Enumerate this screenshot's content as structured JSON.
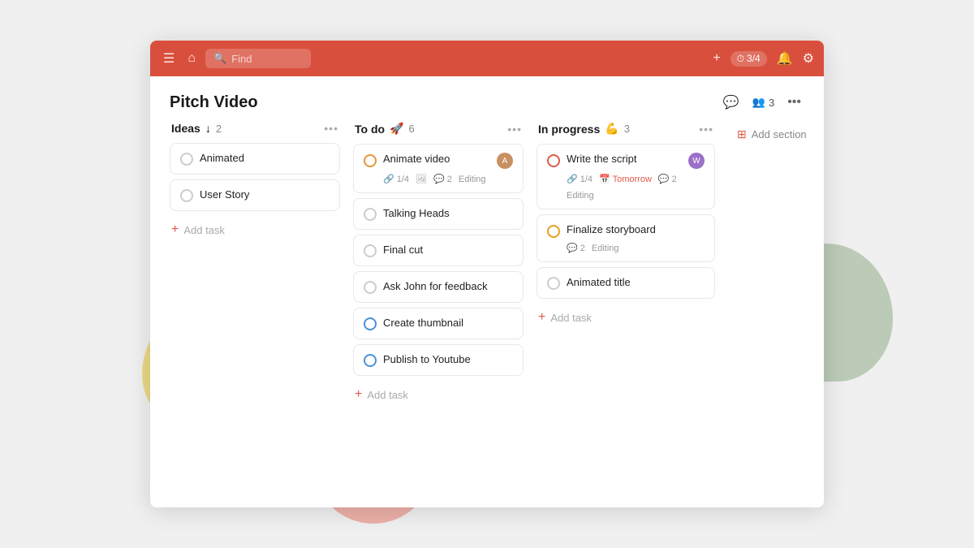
{
  "topbar": {
    "search_placeholder": "Find",
    "avatar_count": "3/4",
    "add_label": "+",
    "bell_icon": "🔔",
    "gear_icon": "⚙",
    "home_icon": "🏠",
    "menu_icon": "☰",
    "timer_icon": "⏱"
  },
  "page": {
    "title": "Pitch Video",
    "members_count": "3",
    "comment_icon": "💬",
    "more_icon": "•••"
  },
  "columns": [
    {
      "id": "ideas",
      "title": "Ideas",
      "emoji": "↓",
      "count": "2",
      "tasks": [
        {
          "id": 1,
          "name": "Animated",
          "circle": "default",
          "meta": []
        },
        {
          "id": 2,
          "name": "User Story",
          "circle": "default",
          "meta": []
        }
      ],
      "add_task_label": "Add task"
    },
    {
      "id": "todo",
      "title": "To do",
      "emoji": "🚀",
      "count": "6",
      "tasks": [
        {
          "id": 3,
          "name": "Animate video",
          "circle": "orange",
          "has_avatar": true,
          "avatar_type": "brown",
          "avatar_initial": "A",
          "meta": [
            {
              "icon": "🔗",
              "text": "1/4"
            },
            {
              "icon": "🖼",
              "text": ""
            },
            {
              "icon": "💬",
              "text": "2"
            },
            {
              "icon": "",
              "text": "Editing"
            }
          ]
        },
        {
          "id": 4,
          "name": "Talking Heads",
          "circle": "default",
          "meta": []
        },
        {
          "id": 5,
          "name": "Final cut",
          "circle": "default",
          "meta": []
        },
        {
          "id": 6,
          "name": "Ask John for feedback",
          "circle": "default",
          "meta": []
        },
        {
          "id": 7,
          "name": "Create thumbnail",
          "circle": "blue-outline",
          "meta": []
        },
        {
          "id": 8,
          "name": "Publish to Youtube",
          "circle": "blue-outline",
          "meta": []
        }
      ],
      "add_task_label": "Add task"
    },
    {
      "id": "inprogress",
      "title": "In progress",
      "emoji": "💪",
      "count": "3",
      "tasks": [
        {
          "id": 9,
          "name": "Write the script",
          "circle": "red-outline",
          "has_avatar": true,
          "avatar_type": "purple",
          "avatar_initial": "W",
          "meta": [
            {
              "icon": "🔗",
              "text": "1/4"
            },
            {
              "icon": "📅",
              "text": "Tomorrow",
              "class": "tomorrow"
            },
            {
              "icon": "💬",
              "text": "2"
            },
            {
              "icon": "",
              "text": "Editing"
            }
          ]
        },
        {
          "id": 10,
          "name": "Finalize storyboard",
          "circle": "orange-outline",
          "meta": [
            {
              "icon": "💬",
              "text": "2"
            },
            {
              "icon": "",
              "text": "Editing"
            }
          ]
        },
        {
          "id": 11,
          "name": "Animated title",
          "circle": "default",
          "meta": []
        }
      ],
      "add_task_label": "Add task"
    }
  ],
  "add_section": {
    "label": "Add section"
  }
}
